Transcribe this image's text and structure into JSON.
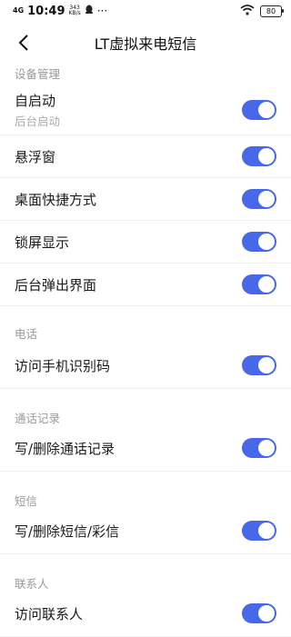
{
  "status_bar": {
    "signal": "4G",
    "time": "10:49",
    "net_speed_value": "343",
    "net_speed_unit": "KB/s",
    "more": "···",
    "battery": "80"
  },
  "header": {
    "title": "LT虚拟来电短信"
  },
  "sections": [
    {
      "title": "设备管理"
    },
    {
      "title": "电话"
    },
    {
      "title": "通话记录"
    },
    {
      "title": "短信"
    },
    {
      "title": "联系人"
    }
  ],
  "rows": {
    "autostart": {
      "label": "自启动",
      "sub": "后台启动",
      "on": true
    },
    "floating_window": {
      "label": "悬浮窗",
      "on": true
    },
    "desktop_shortcut": {
      "label": "桌面快捷方式",
      "on": true
    },
    "lockscreen_display": {
      "label": "锁屏显示",
      "on": true
    },
    "background_popup": {
      "label": "后台弹出界面",
      "on": true
    },
    "phone_identity": {
      "label": "访问手机识别码",
      "on": true
    },
    "call_log": {
      "label": "写/删除通话记录",
      "on": true
    },
    "sms_mms": {
      "label": "写/删除短信/彩信",
      "on": true
    },
    "contacts": {
      "label": "访问联系人",
      "on": true
    }
  },
  "colors": {
    "toggle_on": "#4868ea",
    "section_title": "#9a9a9a"
  }
}
